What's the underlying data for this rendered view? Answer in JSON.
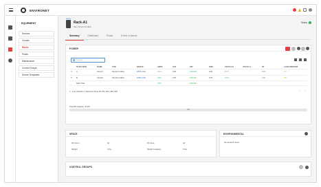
{
  "app": {
    "brand": "ENVIRONET"
  },
  "sidebar": {
    "title": "EQUIPMENT",
    "items": [
      {
        "label": "Devices"
      },
      {
        "label": "Circuits"
      },
      {
        "label": "Racks"
      },
      {
        "label": "Points"
      },
      {
        "label": "Maintenance"
      },
      {
        "label": "Control Groups"
      },
      {
        "label": "Device Templates"
      }
    ]
  },
  "rack": {
    "breadcrumb": "Racks",
    "title": "Rack-A1",
    "subtitle": "Site: DQ-Fort Collins",
    "status_label": "Status"
  },
  "tabs": [
    {
      "label": "Summary"
    },
    {
      "label": "Dashboard"
    },
    {
      "label": "Points"
    },
    {
      "label": "Events & Alarms"
    }
  ],
  "power": {
    "title": "POWER",
    "search_placeholder": "Search",
    "columns": [
      "RACK FEED",
      "NAME",
      "SITE",
      "DEVICE",
      "AMPS",
      "KVA",
      "KW",
      "KWH",
      "VOLTS LN",
      "VOLTS LL",
      "PF",
      "LOAD PERCENT"
    ],
    "rows": [
      {
        "feed": "A",
        "name": "Circuit1",
        "site": "DQ-Fort Collins",
        "device": "EPDU-01A",
        "amps": "0.0 A",
        "kva": "0.00",
        "kw": "0.00 kW",
        "kwh": "0.00",
        "volts_ln": "0.0 V",
        "volts_ll": "",
        "pf": "0.00",
        "load": "0%"
      },
      {
        "feed": "B",
        "name": "Circuit2",
        "site": "DQ-Fort Collins",
        "device": "EPDU-01B",
        "amps": "0.0 A",
        "kva": "0.00",
        "kw": "0.00 kW",
        "kwh": "0.00",
        "volts_ln": "0.0 V",
        "volts_ll": "",
        "pf": "0.00",
        "load": "0%"
      }
    ],
    "total_label": "Rack Total",
    "total_amps": "0.0 A",
    "total_kw": "0.00 kW",
    "pagination": "1 - 2 of 2 Results  |  1 selected  |  Show 25 | 50 | 100 | 250 | 500",
    "total_capacity_label": "Total kW Capacity: 10 kW",
    "capacity_percent": "0%"
  },
  "space": {
    "title": "SPACE",
    "ru_from_label": "RU From",
    "ru_from": "42",
    "ru_free_label": "RU Free",
    "ru_free": "42",
    "weight_label": "Weight",
    "weight": "0 lbs",
    "weight_capacity_label": "Weight Capacity",
    "weight_capacity": "0 lbs"
  },
  "environmental": {
    "title": "ENVIRONMENTAL",
    "empty_text": "No sensors found"
  },
  "control_groups": {
    "title": "CONTROL GROUPS"
  }
}
